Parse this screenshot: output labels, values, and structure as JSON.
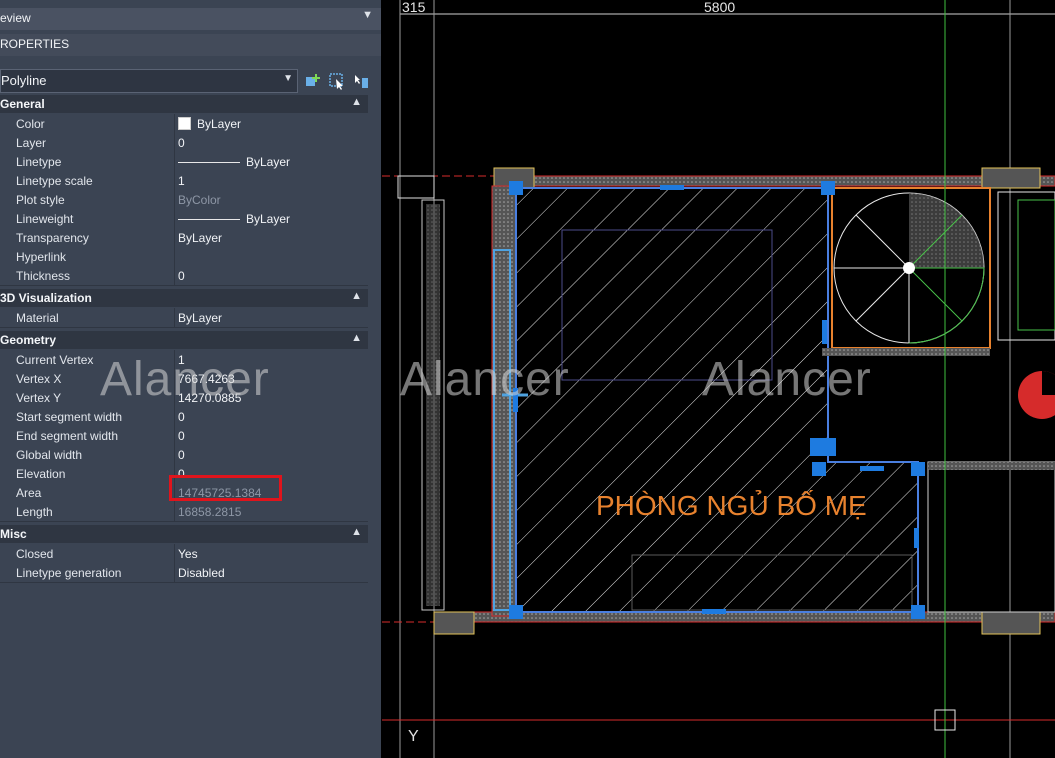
{
  "panel": {
    "view_tab": "eview",
    "properties_title": "ROPERTIES",
    "object_type": "Polyline"
  },
  "sections": [
    {
      "title": "General",
      "rows": [
        {
          "label": "Color",
          "value": "ByLayer"
        },
        {
          "label": "Layer",
          "value": "0"
        },
        {
          "label": "Linetype",
          "value": "ByLayer"
        },
        {
          "label": "Linetype scale",
          "value": "1"
        },
        {
          "label": "Plot style",
          "value": "ByColor"
        },
        {
          "label": "Lineweight",
          "value": "ByLayer"
        },
        {
          "label": "Transparency",
          "value": "ByLayer"
        },
        {
          "label": "Hyperlink",
          "value": ""
        },
        {
          "label": "Thickness",
          "value": "0"
        }
      ]
    },
    {
      "title": "3D Visualization",
      "rows": [
        {
          "label": "Material",
          "value": "ByLayer"
        }
      ]
    },
    {
      "title": "Geometry",
      "rows": [
        {
          "label": "Current Vertex",
          "value": "1"
        },
        {
          "label": "Vertex X",
          "value": "7667.4263"
        },
        {
          "label": "Vertex Y",
          "value": "14270.0885"
        },
        {
          "label": "Start segment width",
          "value": "0"
        },
        {
          "label": "End segment width",
          "value": "0"
        },
        {
          "label": "Global width",
          "value": "0"
        },
        {
          "label": "Elevation",
          "value": "0"
        },
        {
          "label": "Area",
          "value": "14745725.1384"
        },
        {
          "label": "Length",
          "value": "16858.2815"
        }
      ]
    },
    {
      "title": "Misc",
      "rows": [
        {
          "label": "Closed",
          "value": "Yes"
        },
        {
          "label": "Linetype generation",
          "value": "Disabled"
        }
      ]
    }
  ],
  "drawing": {
    "dim_left": "315",
    "dim_top": "5800",
    "room_label": "PHÒNG NGỦ BỐ MẸ",
    "axis_y": "Y"
  },
  "watermark": "Alancer",
  "colors": {
    "panel_bg": "#3b4453",
    "section_bg": "#2f3642",
    "highlight": "#e0141c",
    "room_label": "#e8822e",
    "grip": "#1e7be0",
    "wall_red": "#d62b2b"
  }
}
